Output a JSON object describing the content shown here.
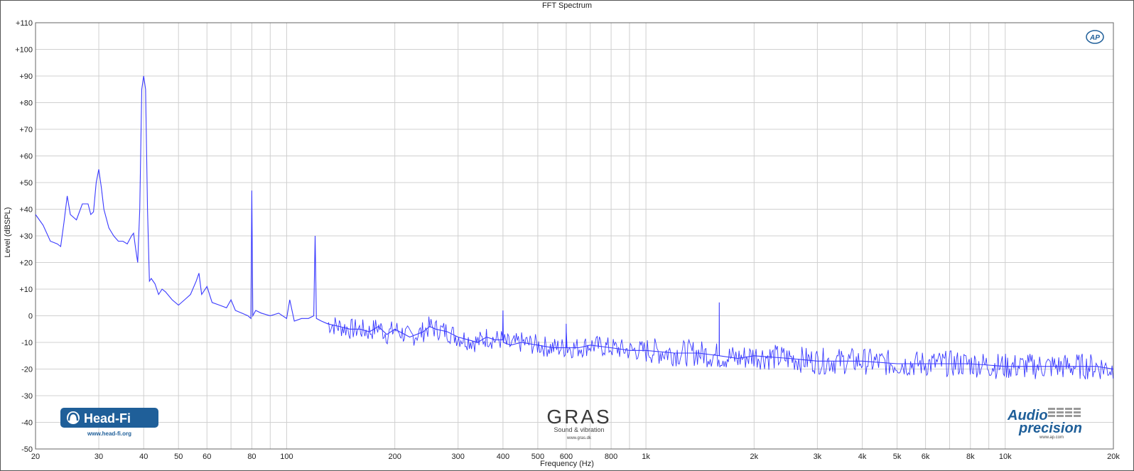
{
  "chart_data": {
    "type": "line",
    "title": "FFT Spectrum",
    "xlabel": "Frequency (Hz)",
    "ylabel": "Level (dBSPL)",
    "x_scale": "log",
    "xlim": [
      20,
      20000
    ],
    "ylim": [
      -50,
      110
    ],
    "grid": true,
    "x_ticks": [
      {
        "value": 20,
        "label": "20"
      },
      {
        "value": 30,
        "label": "30"
      },
      {
        "value": 40,
        "label": "40"
      },
      {
        "value": 50,
        "label": "50"
      },
      {
        "value": 60,
        "label": "60"
      },
      {
        "value": 80,
        "label": "80"
      },
      {
        "value": 100,
        "label": "100"
      },
      {
        "value": 200,
        "label": "200"
      },
      {
        "value": 300,
        "label": "300"
      },
      {
        "value": 400,
        "label": "400"
      },
      {
        "value": 500,
        "label": "500"
      },
      {
        "value": 600,
        "label": "600"
      },
      {
        "value": 800,
        "label": "800"
      },
      {
        "value": 1000,
        "label": "1k"
      },
      {
        "value": 2000,
        "label": "2k"
      },
      {
        "value": 3000,
        "label": "3k"
      },
      {
        "value": 4000,
        "label": "4k"
      },
      {
        "value": 5000,
        "label": "5k"
      },
      {
        "value": 6000,
        "label": "6k"
      },
      {
        "value": 8000,
        "label": "8k"
      },
      {
        "value": 10000,
        "label": "10k"
      },
      {
        "value": 20000,
        "label": "20k"
      }
    ],
    "x_minor_grid": [
      70,
      90,
      700,
      900,
      7000,
      9000
    ],
    "y_ticks": [
      {
        "value": 110,
        "label": "+110"
      },
      {
        "value": 100,
        "label": "+100"
      },
      {
        "value": 90,
        "label": "+90"
      },
      {
        "value": 80,
        "label": "+80"
      },
      {
        "value": 70,
        "label": "+70"
      },
      {
        "value": 60,
        "label": "+60"
      },
      {
        "value": 50,
        "label": "+50"
      },
      {
        "value": 40,
        "label": "+40"
      },
      {
        "value": 30,
        "label": "+30"
      },
      {
        "value": 20,
        "label": "+20"
      },
      {
        "value": 10,
        "label": "+10"
      },
      {
        "value": 0,
        "label": "0"
      },
      {
        "value": -10,
        "label": "-10"
      },
      {
        "value": -20,
        "label": "-20"
      },
      {
        "value": -30,
        "label": "-30"
      },
      {
        "value": -40,
        "label": "-40"
      },
      {
        "value": -50,
        "label": "-50"
      }
    ],
    "series": [
      {
        "color": "#3a3aff",
        "x": [
          20,
          21,
          22,
          23,
          23.5,
          24,
          24.5,
          25,
          26,
          27,
          28,
          28.5,
          29,
          29.5,
          30,
          30.5,
          31,
          32,
          33,
          34,
          35,
          36,
          37,
          37.5,
          38,
          38.5,
          39,
          39.5,
          40,
          40.5,
          41,
          41.5,
          42,
          43,
          44,
          45,
          46,
          48,
          50,
          52,
          54,
          56,
          57,
          58,
          60,
          62,
          65,
          68,
          70,
          72,
          75,
          78,
          79.5,
          80,
          80.5,
          82,
          85,
          90,
          95,
          100,
          102,
          105,
          110,
          115,
          119,
          120,
          121,
          125,
          130,
          140,
          150,
          160,
          170,
          180,
          190,
          200,
          220,
          240,
          250,
          260,
          280,
          300,
          320,
          340,
          360,
          380,
          399,
          400,
          401,
          420,
          450,
          500,
          550,
          599,
          600,
          601,
          650,
          700,
          800,
          900,
          1000,
          1200,
          1400,
          1599,
          1600,
          1601,
          1800,
          2000,
          2500,
          3000,
          4000,
          5000,
          6000,
          8000,
          10000,
          12000,
          15000,
          18000,
          20000
        ],
        "values": [
          38,
          34,
          28,
          27,
          26,
          35,
          45,
          38,
          36,
          42,
          42,
          38,
          39,
          50,
          55,
          48,
          40,
          33,
          30,
          28,
          28,
          27,
          30,
          31,
          25,
          20,
          40,
          85,
          90,
          85,
          40,
          13,
          14,
          12,
          8,
          10,
          9,
          6,
          4,
          6,
          8,
          13,
          16,
          8,
          11,
          5,
          4,
          3,
          6,
          2,
          1,
          0,
          -1,
          47,
          0,
          2,
          1,
          0,
          1,
          -1,
          6,
          -2,
          -1,
          -1,
          0,
          30,
          -1,
          -2,
          -3,
          -4,
          -5,
          -5,
          -6,
          -4,
          -7,
          -5,
          -8,
          -6,
          -4,
          -5,
          -6,
          -8,
          -9,
          -10,
          -8,
          -9,
          -9,
          2,
          -10,
          -11,
          -10,
          -11,
          -12,
          -12,
          -3,
          -12,
          -12,
          -11,
          -12,
          -13,
          -13,
          -14,
          -14,
          -15,
          5,
          -15,
          -16,
          -15,
          -16,
          -17,
          -17,
          -18,
          -18,
          -18,
          -19,
          -19,
          -19,
          -19,
          -20
        ]
      }
    ],
    "annotations": [
      "Head-Fi",
      "www.head-fi.org",
      "GRAS",
      "Sound & vibration",
      "www.gras.dk",
      "Audio",
      "precision",
      "www.ap.com",
      "AP"
    ]
  },
  "logos": {
    "headfi_name": "Head-Fi",
    "headfi_url": "www.head-fi.org",
    "gras_name": "GRAS",
    "gras_tagline": "Sound & vibration",
    "gras_url": "www.gras.dk",
    "ap_line1": "Audio",
    "ap_line2": "precision",
    "ap_url": "www.ap.com",
    "ap_badge": "AP",
    "headfi_color": "#1f5f99",
    "ap_color": "#1f5f99"
  }
}
